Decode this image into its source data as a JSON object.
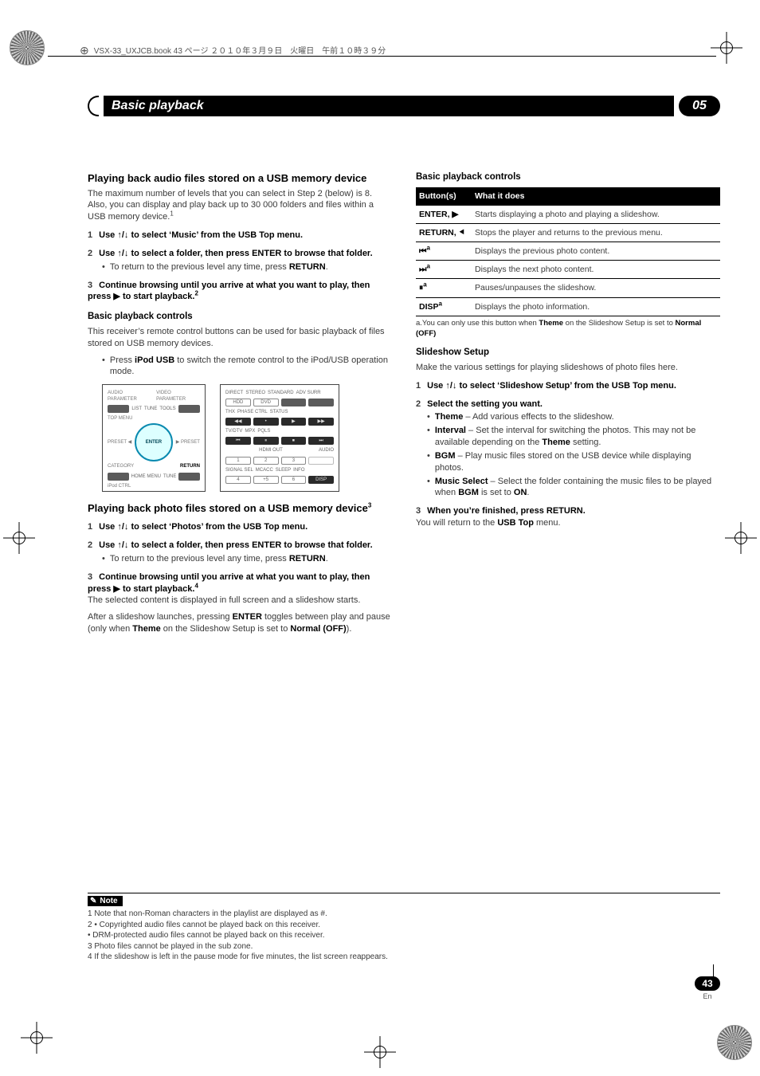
{
  "meta": {
    "line": "VSX-33_UXJCB.book  43 ページ  ２０１０年３月９日　火曜日　午前１０時３９分"
  },
  "header": {
    "title": "Basic playback",
    "chapter": "05"
  },
  "left": {
    "h_audio": "Playing back audio files stored on a USB memory device",
    "audio_intro": "The maximum number of levels that you can select in Step 2 (below) is 8. Also, you can display and play back up to 30 000 folders and files within a USB memory device.",
    "audio_intro_sup": "1",
    "s1": {
      "n": "1",
      "t_pre": "Use ",
      "t_post": " to select ‘Music’ from the USB Top menu."
    },
    "s2": {
      "n": "2",
      "t_pre": "Use ",
      "t_post": " to select a folder, then press ENTER to browse that folder."
    },
    "s2_b1_pre": "To return to the previous level any time, press ",
    "s2_b1_bold": "RETURN",
    "s2_b1_post": ".",
    "s3": {
      "n": "3",
      "t1": "Continue browsing until you arrive at what you want to play, then press ",
      "t2": " to start playback.",
      "sup": "2"
    },
    "h_basic": "Basic playback controls",
    "basic_p": "This receiver’s remote control buttons can be used for basic playback of files stored on USB memory devices.",
    "basic_b1_pre": "Press ",
    "basic_b1_bold": "iPod USB",
    "basic_b1_post": " to switch the remote control to the iPod/USB operation mode.",
    "h_photo_pre": "Playing back photo files stored on a USB memory device",
    "h_photo_sup": "3",
    "p1": {
      "n": "1",
      "t_pre": "Use ",
      "t_post": " to select ‘Photos’ from the USB Top menu."
    },
    "p2": {
      "n": "2",
      "t_pre": "Use ",
      "t_post": " to select a folder, then press ENTER to browse that folder."
    },
    "p2_b1_pre": "To return to the previous level any time, press ",
    "p2_b1_bold": "RETURN",
    "p2_b1_post": ".",
    "p3": {
      "n": "3",
      "t1": "Continue browsing until you arrive at what you want to play, then press ",
      "t2": " to start playback.",
      "sup": "4"
    },
    "p3_after1": "The selected content is displayed in full screen and a slideshow starts.",
    "p3_after2_a": "After a slideshow launches, pressing ",
    "p3_after2_b": "ENTER",
    "p3_after2_c": " toggles between play and pause (only when ",
    "p3_after2_d": "Theme",
    "p3_after2_e": " on the Slideshow Setup is set to ",
    "p3_after2_f": "Normal (OFF)",
    "p3_after2_g": ")."
  },
  "right": {
    "h_basic": "Basic playback controls",
    "thead": {
      "c1": "Button(s)",
      "c2": "What it does"
    },
    "rows": [
      {
        "b": "ENTER, ▶",
        "d": "Starts displaying a photo and playing a slideshow."
      },
      {
        "b": "RETURN, ⯇",
        "d": "Stops the player and returns to the previous menu."
      },
      {
        "b": "⏮",
        "sup": "a",
        "d": "Displays the previous photo content."
      },
      {
        "b": "⏭",
        "sup": "a",
        "d": "Displays the next photo content."
      },
      {
        "b": "⏸",
        "sup": "a",
        "d": "Pauses/unpauses the slideshow."
      },
      {
        "b": "DISP",
        "sup": "a",
        "d": "Displays the photo information."
      }
    ],
    "tfoot_a": "a.You can only use this button when ",
    "tfoot_b": "Theme",
    "tfoot_c": " on the Slideshow Setup is set to ",
    "tfoot_d": "Normal (OFF)",
    "h_slide": "Slideshow Setup",
    "slide_p": "Make the various settings for playing slideshows of photo files here.",
    "ss1": {
      "n": "1",
      "t_pre": "Use ",
      "t_post": " to select ‘Slideshow Setup’ from the USB Top menu."
    },
    "ss2": {
      "n": "2",
      "t": "Select the setting you want."
    },
    "ss2_items": [
      {
        "b": "Theme",
        "t": " – Add various effects to the slideshow."
      },
      {
        "b": "Interval",
        "t1": " – Set the interval for switching the photos. This may not be available depending on the ",
        "b2": "Theme",
        "t2": " setting."
      },
      {
        "b": "BGM",
        "t": " – Play music files stored on the USB device while displaying photos."
      },
      {
        "b": "Music Select",
        "t1": " – Select the folder containing the music files to be played when ",
        "b2": "BGM",
        "t2": " is set to ",
        "b3": "ON",
        "t3": "."
      }
    ],
    "ss3": {
      "n": "3",
      "t": "When you’re finished, press RETURN."
    },
    "ss3_after_a": "You will return to the ",
    "ss3_after_b": "USB Top",
    "ss3_after_c": " menu."
  },
  "notes": {
    "label": "Note",
    "items": [
      "1 Note that non-Roman characters in the playlist are displayed as #.",
      "2 • Copyrighted audio files cannot be played back on this receiver.",
      "   • DRM-protected audio files cannot be played back on this receiver.",
      "3 Photo files cannot be played in the sub zone.",
      "4 If the slideshow is left in the pause mode for five minutes, the list screen reappears."
    ]
  },
  "footer": {
    "page": "43",
    "lang": "En"
  },
  "glyphs": {
    "updown": "↑/↓",
    "play": "▶"
  }
}
